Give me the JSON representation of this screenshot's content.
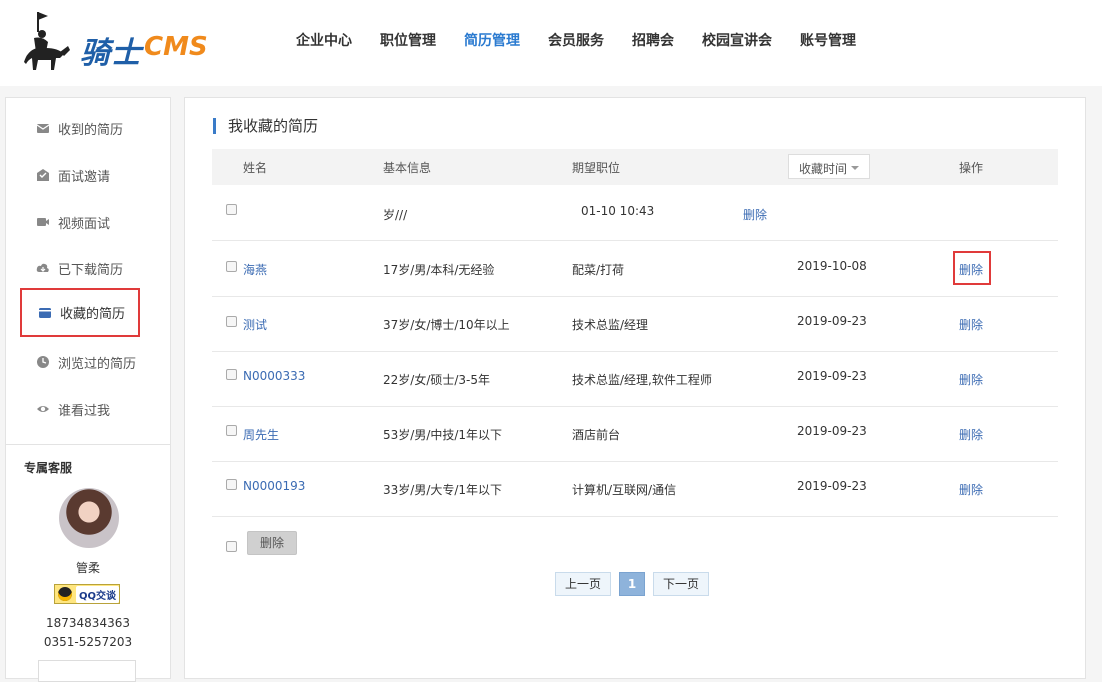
{
  "header": {
    "logo_cn": "骑士",
    "logo_en": "CMS",
    "nav": [
      {
        "label": "企业中心"
      },
      {
        "label": "职位管理"
      },
      {
        "label": "简历管理",
        "active": true
      },
      {
        "label": "会员服务"
      },
      {
        "label": "招聘会"
      },
      {
        "label": "校园宣讲会"
      },
      {
        "label": "账号管理"
      }
    ]
  },
  "sidebar": {
    "items": [
      {
        "label": "收到的简历",
        "icon": "envelope-icon"
      },
      {
        "label": "面试邀请",
        "icon": "invite-icon"
      },
      {
        "label": "视频面试",
        "icon": "video-camera-icon"
      },
      {
        "label": "已下载简历",
        "icon": "cloud-download-icon"
      },
      {
        "label": "收藏的简历",
        "icon": "folder-icon",
        "active": true
      },
      {
        "label": "浏览过的简历",
        "icon": "clock-icon"
      },
      {
        "label": "谁看过我",
        "icon": "eye-icon"
      }
    ],
    "service": {
      "title": "专属客服",
      "name": "管柔",
      "qq_label": "QQ交谈",
      "phone": "18734834363",
      "tel": "0351-5257203"
    }
  },
  "main": {
    "title": "我收藏的简历",
    "columns": {
      "name": "姓名",
      "info": "基本信息",
      "position": "期望职位",
      "time": "收藏时间",
      "action": "操作"
    },
    "rows": [
      {
        "name": "",
        "info": "岁///",
        "position": "",
        "time": "01-10 10:43",
        "action": "删除",
        "broken": true
      },
      {
        "name": "海燕",
        "info": "17岁/男/本科/无经验",
        "position": "配菜/打荷",
        "time": "2019-10-08",
        "action": "删除",
        "highlight": true
      },
      {
        "name": "测试",
        "info": "37岁/女/博士/10年以上",
        "position": "技术总监/经理",
        "time": "2019-09-23",
        "action": "删除"
      },
      {
        "name": "N0000333",
        "info": "22岁/女/硕士/3-5年",
        "position": "技术总监/经理,软件工程师",
        "time": "2019-09-23",
        "action": "删除"
      },
      {
        "name": "周先生",
        "info": "53岁/男/中技/1年以下",
        "position": "酒店前台",
        "time": "2019-09-23",
        "action": "删除"
      },
      {
        "name": "N0000193",
        "info": "33岁/男/大专/1年以下",
        "position": "计算机/互联网/通信",
        "time": "2019-09-23",
        "action": "删除"
      }
    ],
    "batch_delete": "删除",
    "pager": {
      "prev": "上一页",
      "current": "1",
      "next": "下一页"
    }
  }
}
